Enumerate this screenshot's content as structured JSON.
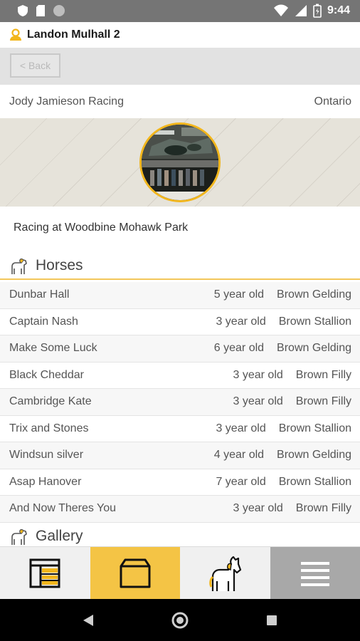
{
  "status_bar": {
    "time": "9:44",
    "icons": [
      "shield-icon",
      "sd-card-icon",
      "circle-icon",
      "wifi-icon",
      "signal-icon",
      "battery-icon"
    ]
  },
  "user": {
    "name": "Landon Mulhall 2",
    "icon": "person-icon"
  },
  "nav": {
    "back_label": "< Back"
  },
  "stable": {
    "name": "Jody Jamieson Racing",
    "region": "Ontario",
    "tagline": "Racing at Woodbine Mohawk Park"
  },
  "horses_section": {
    "title": "Horses",
    "icon": "horse-icon",
    "items": [
      {
        "name": "Dunbar Hall",
        "age": "5 year old",
        "desc": "Brown Gelding"
      },
      {
        "name": "Captain Nash",
        "age": "3 year old",
        "desc": "Brown Stallion"
      },
      {
        "name": "Make Some Luck",
        "age": "6 year old",
        "desc": "Brown Gelding"
      },
      {
        "name": "Black Cheddar",
        "age": "3 year old",
        "desc": "Brown Filly"
      },
      {
        "name": "Cambridge Kate",
        "age": "3 year old",
        "desc": "Brown Filly"
      },
      {
        "name": "Trix and Stones",
        "age": "3 year old",
        "desc": "Brown Stallion"
      },
      {
        "name": "Windsun silver",
        "age": "4 year old",
        "desc": "Brown Gelding"
      },
      {
        "name": "Asap Hanover",
        "age": "7 year old",
        "desc": "Brown Stallion"
      },
      {
        "name": "And Now Theres You",
        "age": "3 year old",
        "desc": "Brown Filly"
      }
    ]
  },
  "gallery_section": {
    "title": "Gallery",
    "icon": "horse-icon"
  },
  "tab_bar": {
    "tabs": [
      {
        "icon": "layout-grid-icon",
        "active": false
      },
      {
        "icon": "stable-folder-icon",
        "active": true
      },
      {
        "icon": "horse-icon",
        "active": false
      },
      {
        "icon": "hamburger-menu-icon",
        "active": false
      }
    ]
  },
  "colors": {
    "accent": "#f4c445",
    "accent_border": "#f2b61c",
    "status_bar": "#757575",
    "nav_bar": "#000000"
  }
}
